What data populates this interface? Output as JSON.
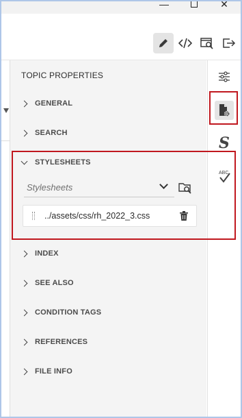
{
  "window": {
    "minimize_glyph": "—",
    "close_glyph": "✕"
  },
  "toolbar": {
    "buttons": [
      {
        "name": "edit",
        "icon": "pencil-icon",
        "active": true
      },
      {
        "name": "source",
        "icon": "code-icon",
        "active": false
      },
      {
        "name": "preview",
        "icon": "preview-icon",
        "active": false
      },
      {
        "name": "export",
        "icon": "export-icon",
        "active": false
      }
    ]
  },
  "panel": {
    "title": "TOPIC PROPERTIES",
    "sections": {
      "general": "GENERAL",
      "search": "SEARCH",
      "stylesheets": "STYLESHEETS",
      "index": "INDEX",
      "see_also": "SEE ALSO",
      "condition_tags": "CONDITION TAGS",
      "references": "REFERENCES",
      "file_info": "FILE INFO"
    },
    "stylesheets": {
      "expanded": true,
      "dropdown_placeholder": "Stylesheets",
      "items": [
        {
          "path": "../assets/css/rh_2022_3.css"
        }
      ]
    }
  },
  "sidebar": {
    "buttons": [
      {
        "name": "settings",
        "icon": "sliders-icon",
        "active": false
      },
      {
        "name": "topic-properties",
        "icon": "document-settings-icon",
        "active": true
      },
      {
        "name": "styles",
        "icon": "styles-s-icon",
        "glyph": "S",
        "active": false
      },
      {
        "name": "spell-check",
        "icon": "spellcheck-icon",
        "glyph": "ABC",
        "active": false
      }
    ]
  },
  "colors": {
    "highlight": "#c0171e",
    "panel_bg": "#f4f4f4",
    "frame_border": "#aec6e8"
  }
}
